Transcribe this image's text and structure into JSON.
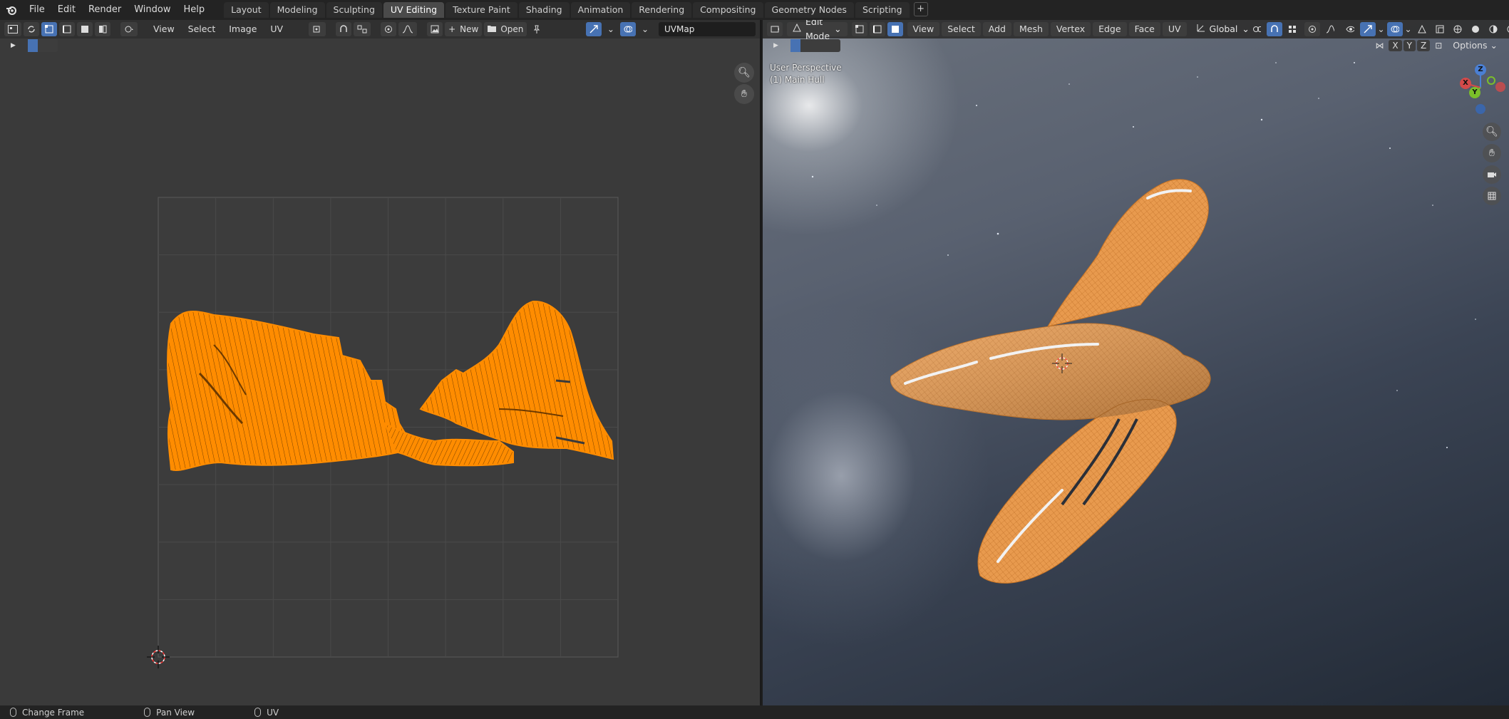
{
  "menubar": {
    "items": [
      "File",
      "Edit",
      "Render",
      "Window",
      "Help"
    ]
  },
  "workspaces": {
    "tabs": [
      "Layout",
      "Modeling",
      "Sculpting",
      "UV Editing",
      "Texture Paint",
      "Shading",
      "Animation",
      "Rendering",
      "Compositing",
      "Geometry Nodes",
      "Scripting"
    ],
    "active": "UV Editing",
    "add_label": "+"
  },
  "uv_editor": {
    "menus": [
      "View",
      "Select",
      "Image",
      "UV"
    ],
    "new_label": "New",
    "open_label": "Open",
    "uv_map_name": "UVMap",
    "accent_color": "#ff8c00"
  },
  "viewport": {
    "mode": "Edit Mode",
    "menus": [
      "View",
      "Select",
      "Add",
      "Mesh",
      "Vertex",
      "Edge",
      "Face",
      "UV"
    ],
    "orientation": "Global",
    "axis_buttons": [
      "X",
      "Y",
      "Z"
    ],
    "options_label": "Options",
    "perspective_label": "User Perspective",
    "object_label": "(1) Main Hull",
    "gizmo": {
      "x": "X",
      "y": "Y",
      "z": "Z"
    }
  },
  "statusbar": {
    "items": [
      {
        "icon": "mouse-left-icon",
        "label": "Change Frame"
      },
      {
        "icon": "mouse-middle-icon",
        "label": "Pan View"
      },
      {
        "icon": "mouse-right-icon",
        "label": "UV"
      }
    ]
  }
}
